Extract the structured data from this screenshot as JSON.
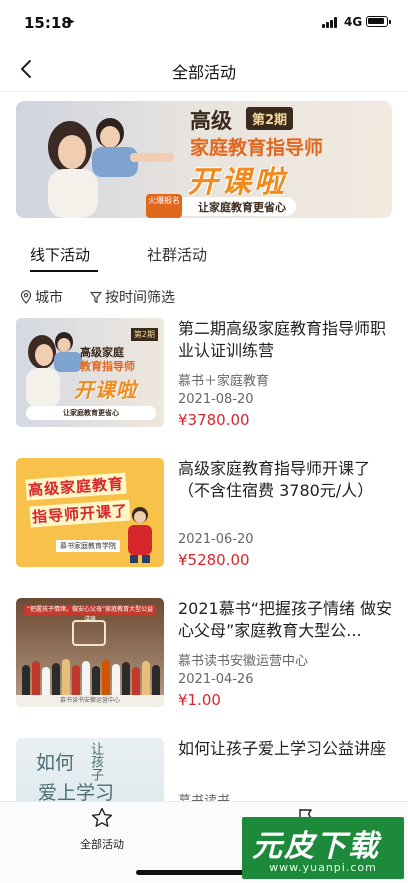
{
  "status_bar": {
    "time": "15:18",
    "network": "4G"
  },
  "nav": {
    "title": "全部活动"
  },
  "banner": {
    "level": "高级",
    "batch": "第2期",
    "course": "家庭教育指导师",
    "headline": "开课啦",
    "slogan": "让家庭教育更省心",
    "badge": "火爆报名"
  },
  "tabs": [
    {
      "label": "线下活动",
      "active": true
    },
    {
      "label": "社群活动",
      "active": false
    }
  ],
  "filters": {
    "city": "城市",
    "time": "按时间筛选"
  },
  "activities": [
    {
      "title": "第二期高级家庭教育指导师职业认证训练营",
      "org": "慕书＋家庭教育",
      "date": "2021-08-20",
      "price": "¥3780.00",
      "thumb": {
        "tag": "第2期",
        "line1": "高级家庭",
        "line2": "教育指导师",
        "line3": "开课啦",
        "line4": "让家庭教育更省心"
      }
    },
    {
      "title": "高级家庭教育指导师开课了（不含住宿费 3780元/人）",
      "org": "",
      "date": "2021-06-20",
      "price": "¥5280.00",
      "thumb": {
        "line1": "高级家庭教育",
        "line2": "指导师开课了",
        "line3": "慕书家庭教育学院"
      }
    },
    {
      "title": "2021慕书“把握孩子情绪 做安心父母”家庭教育大型公...",
      "org": "慕书读书安徽运营中心",
      "date": "2021-04-26",
      "price": "¥1.00",
      "thumb": {
        "banner": "“把握孩子情绪，做安心父母”家庭教育大型公益讲座",
        "footer": "慕书读书安徽运营中心"
      }
    },
    {
      "title": "如何让孩子爱上学习公益讲座",
      "org": "慕书读书",
      "date": "",
      "price": "",
      "thumb": {
        "line1": "如何",
        "line2": "爱上学习",
        "line3": "让孩子"
      }
    }
  ],
  "tabbar": [
    {
      "label": "全部活动",
      "icon": "star-icon"
    },
    {
      "label": "",
      "icon": "flag-icon"
    }
  ],
  "watermark": {
    "title": "元皮下载",
    "url": "www.yuanpi.com"
  },
  "colors": {
    "price": "#d6272d",
    "accent_orange": "#f08a1c",
    "watermark_green": "#1c8a3a"
  }
}
